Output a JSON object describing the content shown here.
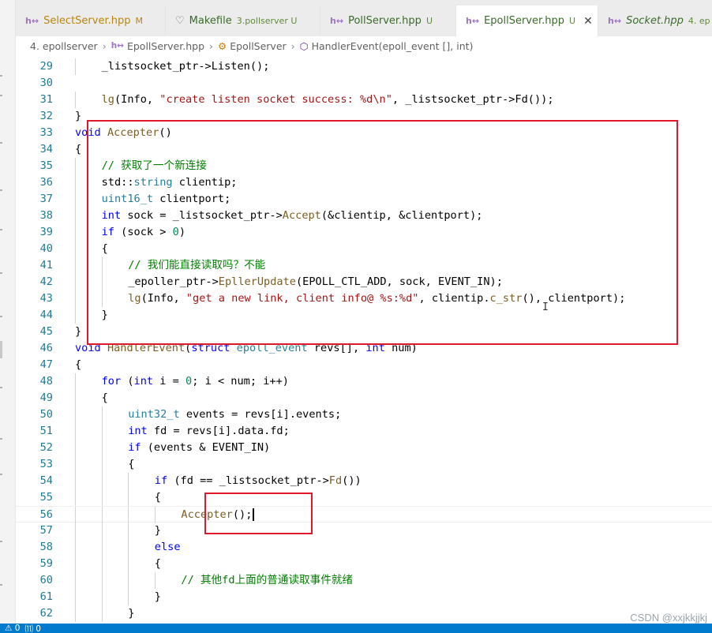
{
  "tabs": [
    {
      "icon": "h++",
      "name": "SelectServer.hpp",
      "suffix": "M",
      "status": "modified",
      "active": false
    },
    {
      "icon": "makefile",
      "name": "Makefile",
      "suffix": "3.pollserver U",
      "status": "untracked",
      "active": false
    },
    {
      "icon": "h++",
      "name": "PollServer.hpp",
      "suffix": "U",
      "status": "untracked",
      "active": false
    },
    {
      "icon": "h++",
      "name": "EpollServer.hpp",
      "suffix": "U",
      "status": "untracked",
      "active": true
    },
    {
      "icon": "h++",
      "name": "Socket.hpp",
      "suffix": "4. ep",
      "status": "untracked",
      "active": false
    }
  ],
  "breadcrumb": {
    "folder": "4. epollserver",
    "file": "EpollServer.hpp",
    "class": "EpollServer",
    "method": "HandlerEvent(epoll_event [], int)"
  },
  "code_lines": [
    {
      "n": "29",
      "indent": 2,
      "tokens": [
        [
          "",
          "_listsocket_ptr->Listen();"
        ]
      ]
    },
    {
      "n": "30",
      "indent": 0,
      "tokens": []
    },
    {
      "n": "31",
      "indent": 2,
      "tokens": [
        [
          "f",
          "lg"
        ],
        [
          "",
          "(Info, "
        ],
        [
          "s",
          "\"create listen socket success: %d\\n\""
        ],
        [
          "",
          ", _listsocket_ptr->Fd());"
        ]
      ]
    },
    {
      "n": "32",
      "indent": 1,
      "tokens": [
        [
          "",
          "}"
        ]
      ]
    },
    {
      "n": "33",
      "indent": 1,
      "tokens": [
        [
          "k",
          "void"
        ],
        [
          "",
          " "
        ],
        [
          "f",
          "Accepter"
        ],
        [
          "",
          "()"
        ]
      ]
    },
    {
      "n": "34",
      "indent": 1,
      "tokens": [
        [
          "",
          "{"
        ]
      ]
    },
    {
      "n": "35",
      "indent": 2,
      "tokens": [
        [
          "c",
          "// 获取了一个新连接"
        ]
      ]
    },
    {
      "n": "36",
      "indent": 2,
      "tokens": [
        [
          "",
          "std::"
        ],
        [
          "t",
          "string"
        ],
        [
          "",
          " clientip;"
        ]
      ]
    },
    {
      "n": "37",
      "indent": 2,
      "tokens": [
        [
          "t",
          "uint16_t"
        ],
        [
          "",
          " clientport;"
        ]
      ]
    },
    {
      "n": "38",
      "indent": 2,
      "tokens": [
        [
          "k",
          "int"
        ],
        [
          "",
          " sock = _listsocket_ptr->"
        ],
        [
          "f",
          "Accept"
        ],
        [
          "",
          "(&clientip, &clientport);"
        ]
      ]
    },
    {
      "n": "39",
      "indent": 2,
      "tokens": [
        [
          "k",
          "if"
        ],
        [
          "",
          " (sock > "
        ],
        [
          "n",
          "0"
        ],
        [
          "",
          ")"
        ]
      ]
    },
    {
      "n": "40",
      "indent": 2,
      "tokens": [
        [
          "",
          "{"
        ]
      ]
    },
    {
      "n": "41",
      "indent": 3,
      "tokens": [
        [
          "c",
          "// 我们能直接读取吗？不能"
        ]
      ]
    },
    {
      "n": "42",
      "indent": 3,
      "tokens": [
        [
          "",
          "_epoller_ptr->"
        ],
        [
          "f",
          "EpllerUpdate"
        ],
        [
          "",
          "(EPOLL_CTL_ADD, sock, EVENT_IN);"
        ]
      ]
    },
    {
      "n": "43",
      "indent": 3,
      "tokens": [
        [
          "f",
          "lg"
        ],
        [
          "",
          "(Info, "
        ],
        [
          "s",
          "\"get a new link, client info@ %s:%d\""
        ],
        [
          "",
          ", clientip."
        ],
        [
          "f",
          "c_str"
        ],
        [
          "",
          "(), clientport);"
        ]
      ]
    },
    {
      "n": "44",
      "indent": 2,
      "tokens": [
        [
          "",
          "}"
        ]
      ]
    },
    {
      "n": "45",
      "indent": 1,
      "tokens": [
        [
          "",
          "}"
        ]
      ]
    },
    {
      "n": "46",
      "indent": 1,
      "tokens": [
        [
          "k",
          "void"
        ],
        [
          "",
          " "
        ],
        [
          "f",
          "HandlerEvent"
        ],
        [
          "",
          "("
        ],
        [
          "k",
          "struct"
        ],
        [
          "",
          " "
        ],
        [
          "t",
          "epoll_event"
        ],
        [
          "",
          " revs[], "
        ],
        [
          "k",
          "int"
        ],
        [
          "",
          " num)"
        ]
      ]
    },
    {
      "n": "47",
      "indent": 1,
      "tokens": [
        [
          "",
          "{"
        ]
      ]
    },
    {
      "n": "48",
      "indent": 2,
      "tokens": [
        [
          "k",
          "for"
        ],
        [
          "",
          " ("
        ],
        [
          "k",
          "int"
        ],
        [
          "",
          " i = "
        ],
        [
          "n",
          "0"
        ],
        [
          "",
          "; i < num; i++)"
        ]
      ]
    },
    {
      "n": "49",
      "indent": 2,
      "tokens": [
        [
          "",
          "{"
        ]
      ]
    },
    {
      "n": "50",
      "indent": 3,
      "tokens": [
        [
          "t",
          "uint32_t"
        ],
        [
          "",
          " events = revs[i].events;"
        ]
      ]
    },
    {
      "n": "51",
      "indent": 3,
      "tokens": [
        [
          "k",
          "int"
        ],
        [
          "",
          " fd = revs[i].data.fd;"
        ]
      ]
    },
    {
      "n": "52",
      "indent": 3,
      "tokens": [
        [
          "k",
          "if"
        ],
        [
          "",
          " (events & EVENT_IN)"
        ]
      ]
    },
    {
      "n": "53",
      "indent": 3,
      "tokens": [
        [
          "",
          "{"
        ]
      ]
    },
    {
      "n": "54",
      "indent": 4,
      "tokens": [
        [
          "k",
          "if"
        ],
        [
          "",
          " (fd == _listsocket_ptr->"
        ],
        [
          "f",
          "Fd"
        ],
        [
          "",
          "())"
        ]
      ]
    },
    {
      "n": "55",
      "indent": 4,
      "tokens": [
        [
          "",
          "{"
        ]
      ]
    },
    {
      "n": "56",
      "indent": 5,
      "tokens": [
        [
          "f",
          "Accepter"
        ],
        [
          "",
          "();"
        ]
      ],
      "cursor": true
    },
    {
      "n": "57",
      "indent": 4,
      "tokens": [
        [
          "",
          "}"
        ]
      ]
    },
    {
      "n": "58",
      "indent": 4,
      "tokens": [
        [
          "k",
          "else"
        ]
      ]
    },
    {
      "n": "59",
      "indent": 4,
      "tokens": [
        [
          "",
          "{"
        ]
      ]
    },
    {
      "n": "60",
      "indent": 5,
      "tokens": [
        [
          "c",
          "// 其他fd上面的普通读取事件就绪"
        ]
      ]
    },
    {
      "n": "61",
      "indent": 4,
      "tokens": [
        [
          "",
          "}"
        ]
      ]
    },
    {
      "n": "62",
      "indent": 3,
      "tokens": [
        [
          "",
          "}"
        ]
      ]
    }
  ],
  "status": {
    "errors": "⚠ 0",
    "ports": "⑾ 0"
  },
  "watermark": "CSDN @xxjkkjjkj",
  "colors": {
    "annotation_box": "#e0192a",
    "statusbar": "#007acc",
    "keyword": "#0000ff",
    "comment": "#008000",
    "string": "#a31515"
  }
}
